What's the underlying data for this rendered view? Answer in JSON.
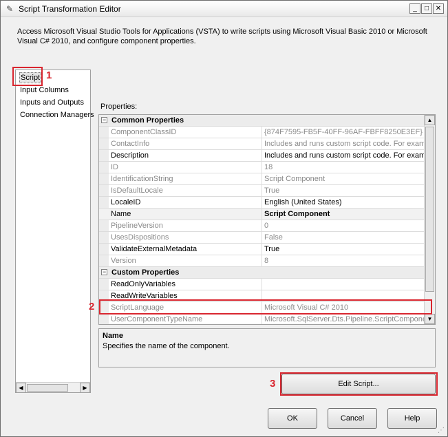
{
  "window": {
    "title": "Script Transformation Editor",
    "icon": "script-component-icon",
    "controls": {
      "minimize": "_",
      "maximize": "□",
      "close": "✕"
    }
  },
  "description": "Access Microsoft Visual Studio Tools for Applications (VSTA) to write scripts using Microsoft Visual Basic 2010 or Microsoft Visual C# 2010, and configure component properties.",
  "nav": {
    "items": [
      "Script",
      "Input Columns",
      "Inputs and Outputs",
      "Connection Managers"
    ],
    "selected": "Script"
  },
  "properties": {
    "label": "Properties:",
    "categories": [
      {
        "label": "Common Properties",
        "rows": [
          {
            "name": "ComponentClassID",
            "value": "{874F7595-FB5F-40FF-96AF-FBFF8250E3EF}",
            "readonly": true
          },
          {
            "name": "ContactInfo",
            "value": "Includes and runs custom script code. For examp",
            "readonly": true
          },
          {
            "name": "Description",
            "value": "Includes and runs custom script code. For examp",
            "readonly": false
          },
          {
            "name": "ID",
            "value": "18",
            "readonly": true
          },
          {
            "name": "IdentificationString",
            "value": "Script Component",
            "readonly": true
          },
          {
            "name": "IsDefaultLocale",
            "value": "True",
            "readonly": true
          },
          {
            "name": "LocaleID",
            "value": "English (United States)",
            "readonly": false
          },
          {
            "name": "Name",
            "value": "Script Component",
            "readonly": false,
            "bold": true
          },
          {
            "name": "PipelineVersion",
            "value": "0",
            "readonly": true
          },
          {
            "name": "UsesDispositions",
            "value": "False",
            "readonly": true
          },
          {
            "name": "ValidateExternalMetadata",
            "value": "True",
            "readonly": false
          },
          {
            "name": "Version",
            "value": "8",
            "readonly": true
          }
        ]
      },
      {
        "label": "Custom Properties",
        "rows": [
          {
            "name": "ReadOnlyVariables",
            "value": "",
            "readonly": false
          },
          {
            "name": "ReadWriteVariables",
            "value": "",
            "readonly": false
          },
          {
            "name": "ScriptLanguage",
            "value": "Microsoft Visual C# 2010",
            "readonly": true
          },
          {
            "name": "UserComponentTypeName",
            "value": "Microsoft.SqlServer.Dts.Pipeline.ScriptComponent",
            "readonly": true
          }
        ]
      }
    ]
  },
  "help": {
    "title": "Name",
    "text": "Specifies the name of the component."
  },
  "buttons": {
    "edit_script": "Edit Script...",
    "ok": "OK",
    "cancel": "Cancel",
    "help": "Help"
  },
  "callouts": {
    "one": "1",
    "two": "2",
    "three": "3"
  },
  "colors": {
    "callout": "#d9262f",
    "readonly_text": "#8a8a8a"
  }
}
